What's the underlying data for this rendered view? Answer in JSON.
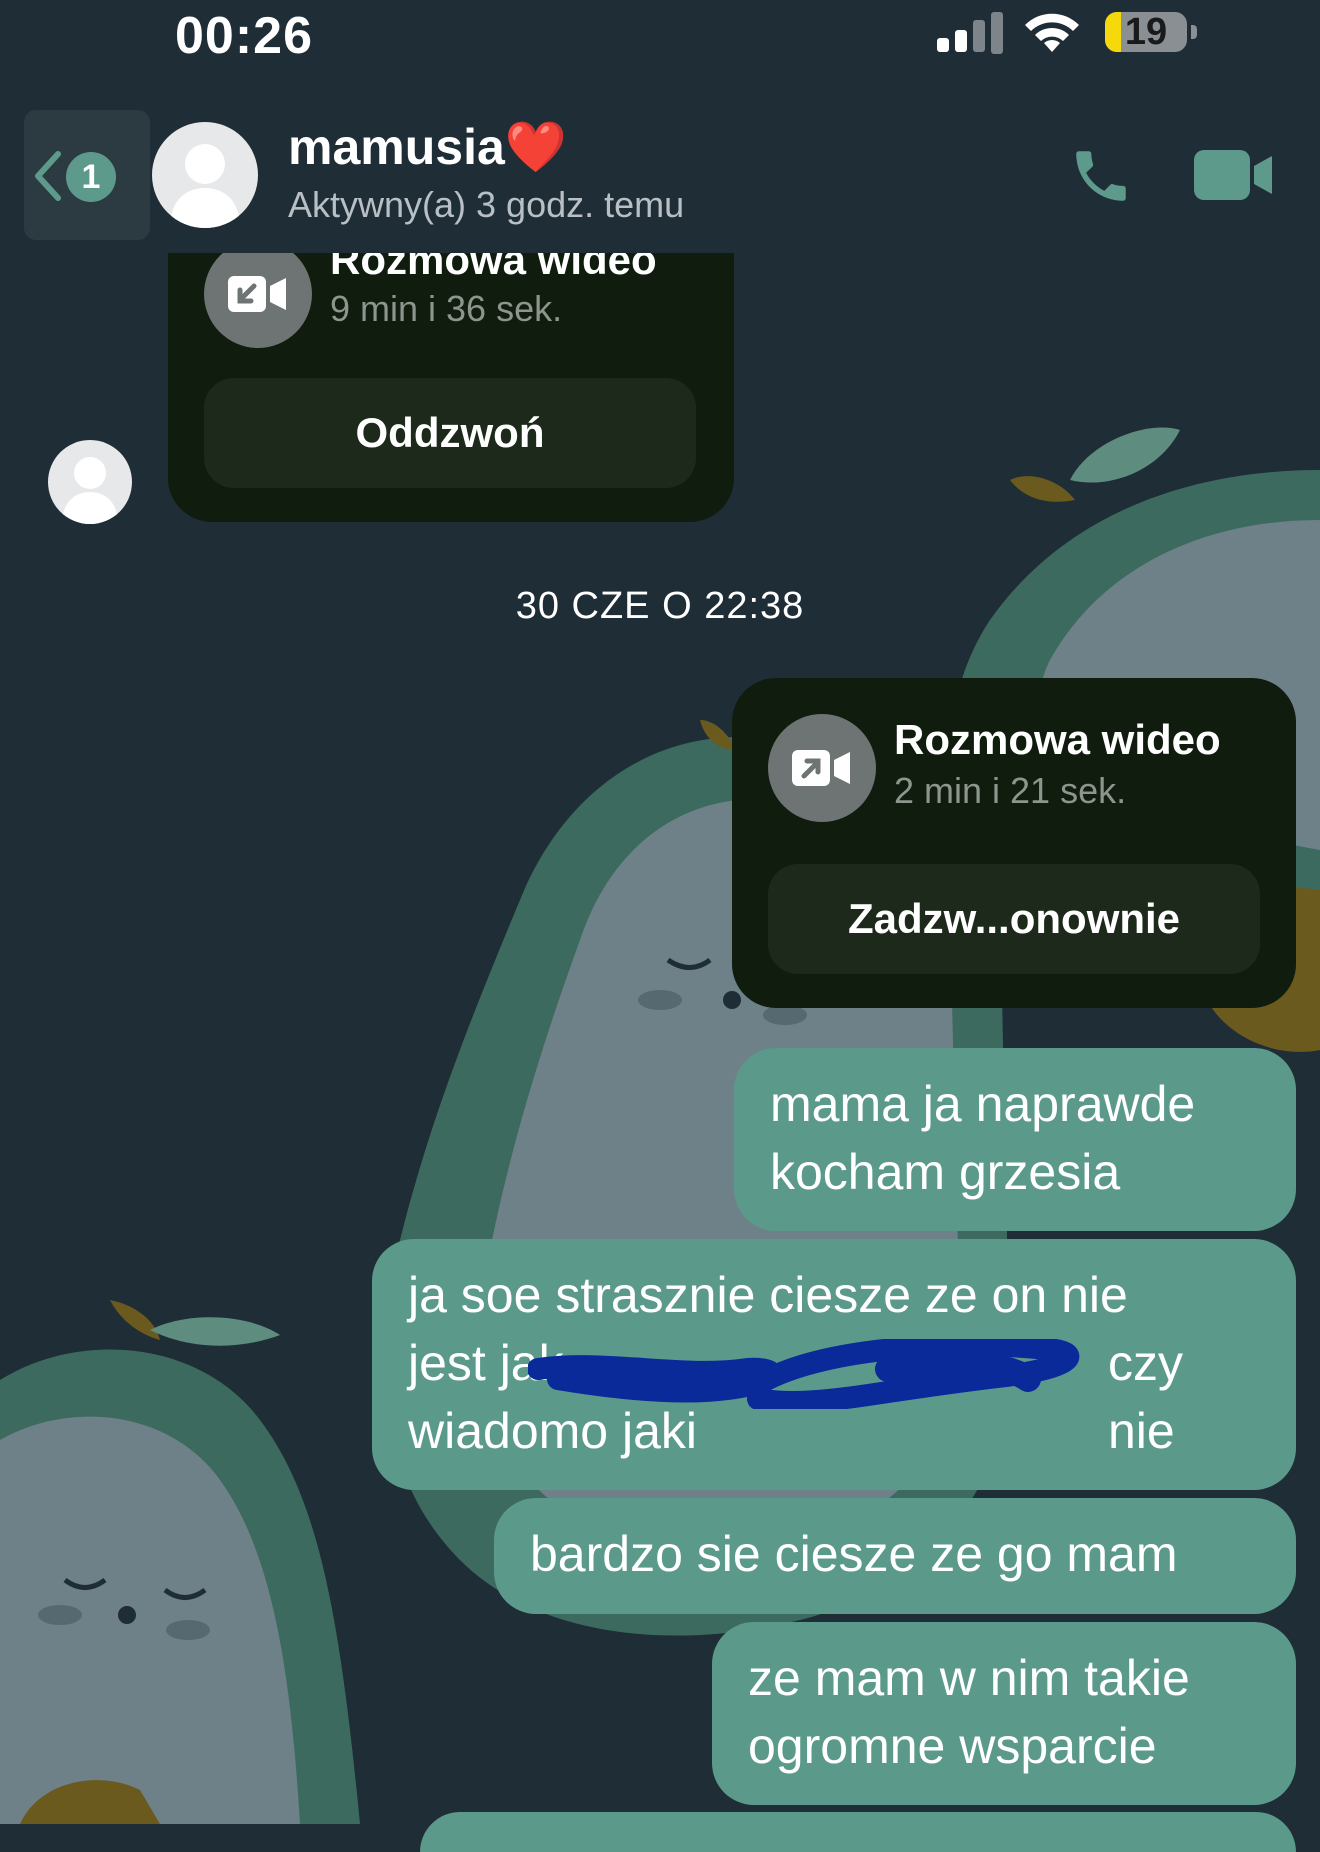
{
  "status_bar": {
    "time": "00:26",
    "battery": "19",
    "battery_level": 0.19
  },
  "header": {
    "back_badge": "1",
    "contact_name": "mamusia",
    "contact_emoji": "❤️",
    "contact_status": "Aktywny(a) 3 godz. temu"
  },
  "messages": {
    "call1": {
      "title": "Rozmowa wideo",
      "duration": "9 min i 36 sek.",
      "button": "Oddzwoń"
    },
    "timestamp": "30 CZE O 22:38",
    "call2": {
      "title": "Rozmowa wideo",
      "duration": "2 min i 21 sek.",
      "button": "Zadzw...onownie"
    },
    "msg1": [
      "mama ja naprawde",
      "kocham grzesia"
    ],
    "msg2": [
      "ja soe strasznie ciesze ze on nie",
      "jest jak",
      "czy nie",
      "wiadomo jaki"
    ],
    "msg3": [
      "bardzo sie ciesze ze go mam"
    ],
    "msg4": [
      "ze mam w nim takie",
      "ogromne wsparcie"
    ]
  },
  "colors": {
    "background": "#1f2d36",
    "bubble_outgoing": "#5b9a8b",
    "call_bubble": "#0f1c0e",
    "accent": "#5e9a8c"
  }
}
